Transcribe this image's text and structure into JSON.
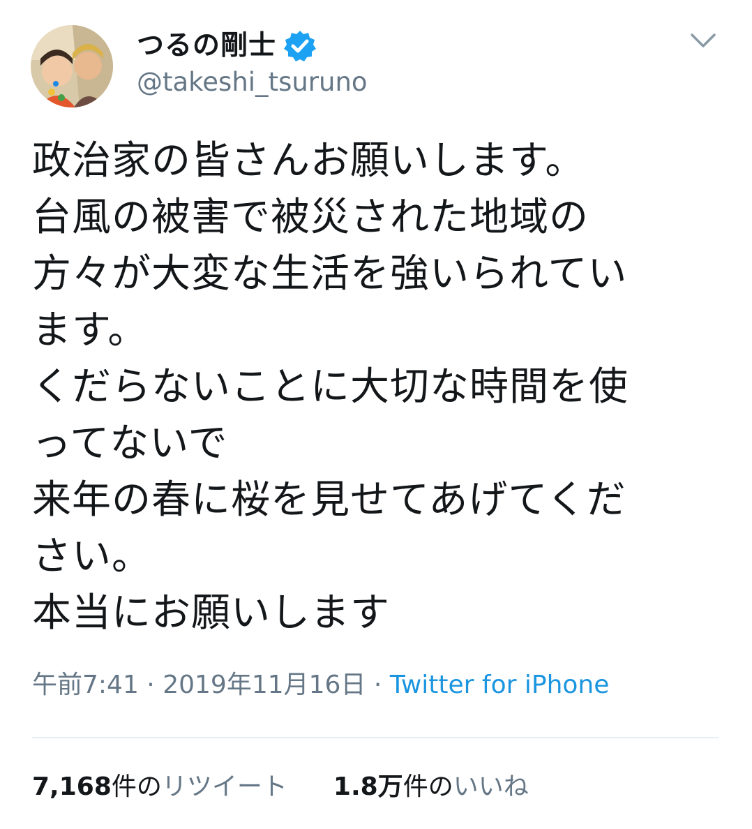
{
  "author": {
    "display_name": "つるの剛士",
    "handle": "@takeshi_tsuruno",
    "verified": true,
    "avatar_icon": "profile-photo"
  },
  "tweet": {
    "lines": [
      "政治家の皆さんお願いします。",
      "台風の被害で被災された地域の",
      "方々が大変な生活を強いられてい",
      "ます。",
      "くだらないことに大切な時間を使",
      "ってないで",
      "来年の春に桜を見せてあげてくだ",
      "さい。",
      "本当にお願いします"
    ]
  },
  "meta": {
    "time": "午前7:41",
    "separator": "·",
    "date": "2019年11月16日",
    "source": "Twitter for iPhone"
  },
  "stats": {
    "retweets": {
      "count": "7,168",
      "unit": "件の",
      "label": "リツイート"
    },
    "likes": {
      "count": "1.8万",
      "unit": "件の",
      "label": "いいね"
    }
  },
  "colors": {
    "text": "#14171a",
    "secondary": "#657786",
    "link": "#1b95e0",
    "verified": "#1da1f2",
    "divider": "#e6ecf0"
  }
}
